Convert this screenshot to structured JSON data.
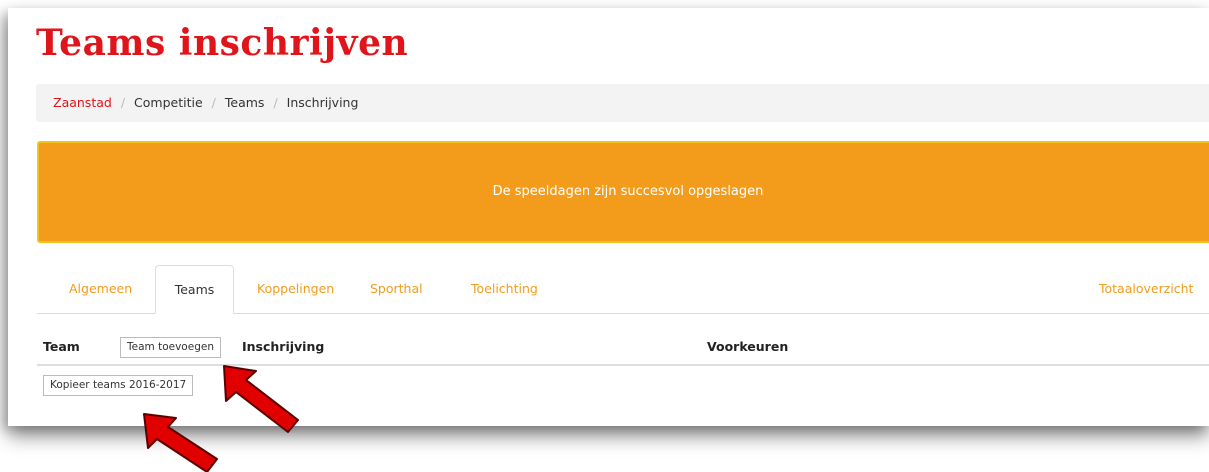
{
  "page": {
    "title": "Teams inschrijven"
  },
  "breadcrumb": {
    "items": [
      "Zaanstad",
      "Competitie",
      "Teams",
      "Inschrijving"
    ],
    "separator": "/"
  },
  "alert": {
    "message": "De speeldagen zijn succesvol opgeslagen",
    "color": "#f39c1c"
  },
  "tabs": {
    "items": [
      "Algemeen",
      "Teams",
      "Koppelingen",
      "Sporthal",
      "Toelichting"
    ],
    "active": "Teams",
    "right_link": "Totaaloverzicht"
  },
  "table": {
    "headers": {
      "team": "Team",
      "inschrijving": "Inschrijving",
      "voorkeuren": "Voorkeuren"
    },
    "add_team_button": "Team toevoegen",
    "copy_teams_button": "Kopieer teams 2016-2017"
  },
  "colors": {
    "brand_red": "#e0141b",
    "accent_orange": "#f39c1c",
    "annotation_arrow": "#e00000"
  }
}
